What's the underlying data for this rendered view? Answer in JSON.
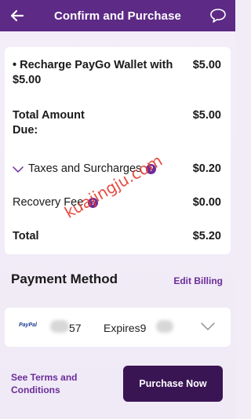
{
  "header": {
    "title": "Confirm and Purchase",
    "back_icon": "arrow-left-icon",
    "chat_icon": "chat-bubble-icon"
  },
  "summary": {
    "item_label": "• Recharge PayGo Wallet with $5.00",
    "item_amount": "$5.00",
    "total_due_label": "Total Amount Due:",
    "total_due_amount": "$5.00",
    "taxes_label": "Taxes and Surcharges",
    "taxes_amount": "$0.20",
    "recovery_label": "Recovery Fee",
    "recovery_amount": "$0.00",
    "total_label": "Total",
    "total_amount": "$5.20",
    "info_glyph": "?"
  },
  "payment": {
    "title": "Payment Method",
    "edit_label": "Edit Billing",
    "provider_label": "PayPal",
    "card_last": "57",
    "expires_label": "Expires9"
  },
  "footer": {
    "terms_label": "See Terms and Conditions",
    "purchase_label": "Purchase Now"
  },
  "watermark": "kuajingju.com",
  "colors": {
    "header": "#5d2a86",
    "accent": "#6a2d98",
    "button": "#3a1554",
    "background": "#f1ecf6"
  }
}
